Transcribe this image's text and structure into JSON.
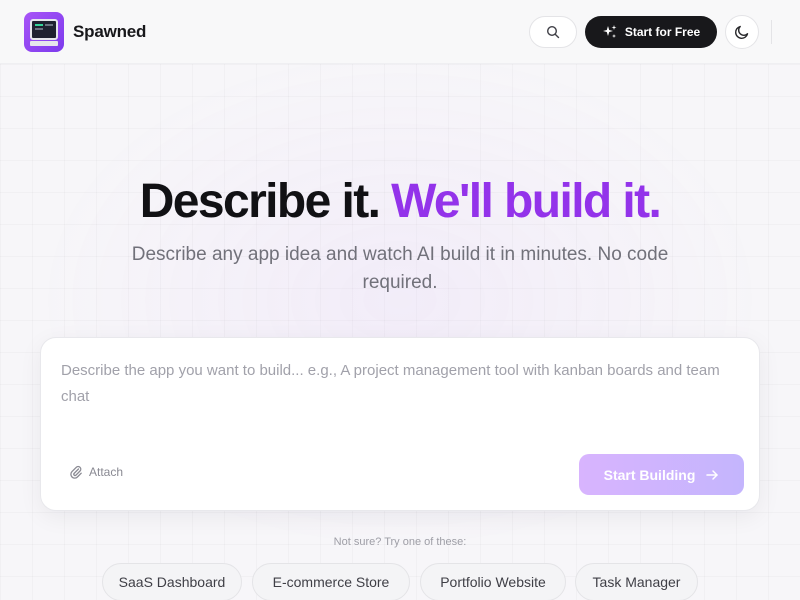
{
  "header": {
    "brand_name": "Spawned",
    "logo_icon": "terminal-monitor-icon",
    "search_icon": "search-icon",
    "start_free_label": "Start for Free",
    "start_free_icon": "sparkles-icon",
    "theme_icon": "moon-icon"
  },
  "hero": {
    "title_main": "Describe it.",
    "title_accent": "We'll build it.",
    "subtitle": "Describe any app idea and watch AI build it in minutes. No code required."
  },
  "prompt": {
    "placeholder": "Describe the app you want to build... e.g., A project management tool with kanban boards and team chat",
    "attach_label": "Attach",
    "attach_icon": "paperclip-icon",
    "submit_label": "Start Building",
    "submit_icon": "arrow-right-icon"
  },
  "suggestions": {
    "label": "Not sure? Try one of these:",
    "items": [
      "SaaS Dashboard",
      "E-commerce Store",
      "Portfolio Website",
      "Task Manager"
    ]
  },
  "colors": {
    "accent": "#9333ea",
    "primary_button": "#18181b",
    "submit_gradient_start": "#d8b4fe",
    "submit_gradient_end": "#c4b5fd"
  }
}
